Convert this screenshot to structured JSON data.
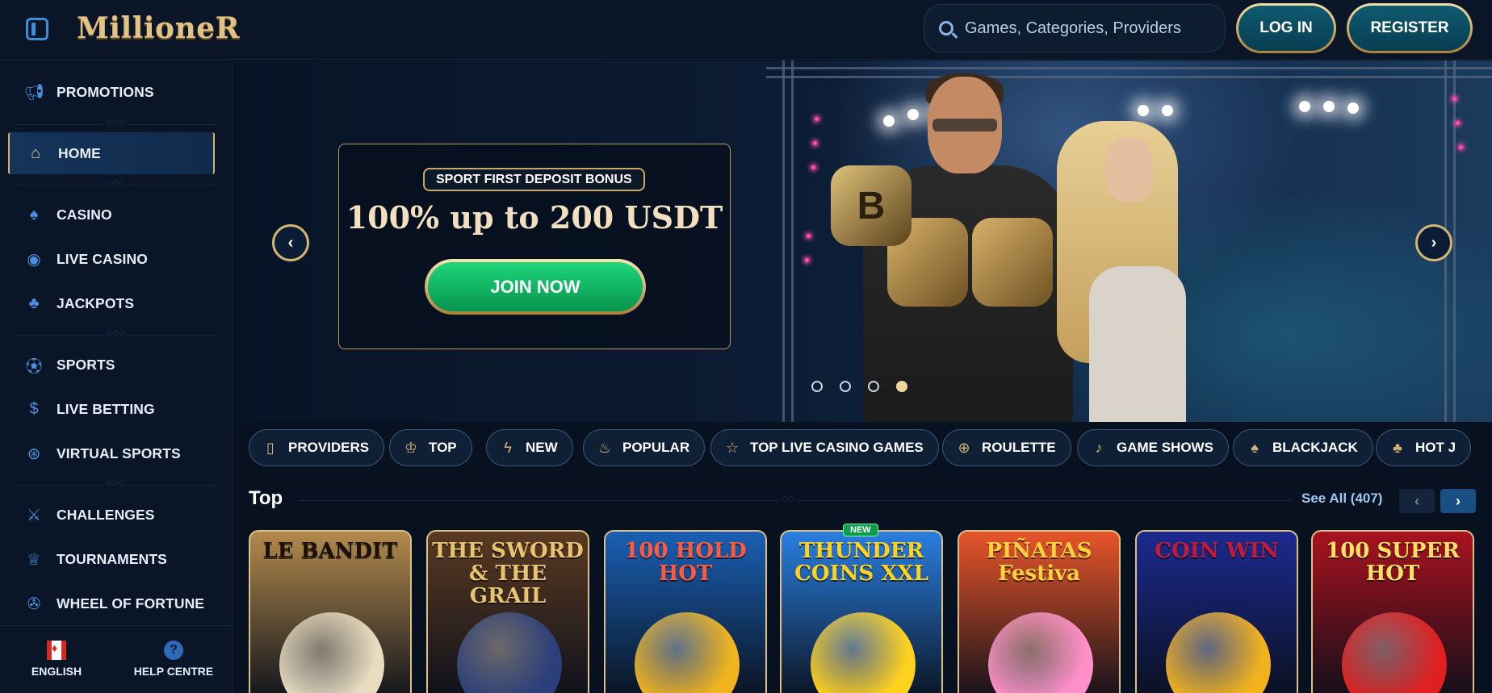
{
  "header": {
    "logo": "MillioneR",
    "search_placeholder": "Games, Categories, Providers",
    "login_label": "LOG IN",
    "register_label": "REGISTER"
  },
  "sidebar": {
    "items": [
      {
        "label": "PROMOTIONS",
        "icon": "megaphone-icon"
      },
      {
        "label": "HOME",
        "icon": "home-icon",
        "active": true
      },
      {
        "label": "CASINO",
        "icon": "spade-icon"
      },
      {
        "label": "LIVE CASINO",
        "icon": "live-casino-icon"
      },
      {
        "label": "JACKPOTS",
        "icon": "clover-icon"
      },
      {
        "label": "SPORTS",
        "icon": "soccer-ball-icon"
      },
      {
        "label": "LIVE BETTING",
        "icon": "dollar-coin-icon"
      },
      {
        "label": "VIRTUAL SPORTS",
        "icon": "virtual-sports-icon"
      },
      {
        "label": "CHALLENGES",
        "icon": "crossed-swords-icon"
      },
      {
        "label": "TOURNAMENTS",
        "icon": "trophy-icon"
      },
      {
        "label": "WHEEL OF FORTUNE",
        "icon": "wheel-icon"
      }
    ],
    "footer": {
      "language_label": "ENGLISH",
      "help_label": "HELP CENTRE",
      "help_icon_glyph": "?"
    }
  },
  "hero": {
    "tag": "SPORT FIRST DEPOSIT BONUS",
    "title": "100% up to 200 USDT",
    "cta_label": "JOIN NOW",
    "coin_glyph": "B",
    "slides_count": 4,
    "active_slide": 4
  },
  "categories": [
    {
      "label": "PROVIDERS",
      "icon": "book-icon",
      "glyph": "▯"
    },
    {
      "label": "TOP",
      "icon": "crown-icon",
      "glyph": "♔"
    },
    {
      "label": "NEW",
      "icon": "lightning-icon",
      "glyph": "ϟ"
    },
    {
      "label": "POPULAR",
      "icon": "flame-icon",
      "glyph": "♨"
    },
    {
      "label": "TOP LIVE CASINO GAMES",
      "icon": "star-icon",
      "glyph": "☆"
    },
    {
      "label": "ROULETTE",
      "icon": "roulette-icon",
      "glyph": "⊕"
    },
    {
      "label": "GAME SHOWS",
      "icon": "microphone-icon",
      "glyph": "♪"
    },
    {
      "label": "BLACKJACK",
      "icon": "cards-icon",
      "glyph": "♠"
    },
    {
      "label": "HOT J",
      "icon": "chili-icon",
      "glyph": "♣"
    }
  ],
  "section": {
    "title": "Top",
    "see_all": "See All (407)",
    "prev_glyph": "‹",
    "next_glyph": "›"
  },
  "games": [
    {
      "title": "LE BANDIT",
      "bg": "#b38a4d",
      "art": "#e8dcc0",
      "color": "#1a1208"
    },
    {
      "title": "THE SWORD & THE GRAIL",
      "bg": "#5a3a22",
      "art": "#2b3f7a",
      "color": "#e8c370"
    },
    {
      "title": "100 HOLD HOT",
      "bg": "#1a5fb4",
      "art": "#f0b41e",
      "color": "#ff5a3c"
    },
    {
      "title": "THUNDER COINS XXL",
      "bg": "#2a7fe0",
      "art": "#ffd21e",
      "color": "#ffd21e",
      "badge": "NEW"
    },
    {
      "title": "PIÑATAS Festiva",
      "bg": "#e8552a",
      "art": "#ff8fc8",
      "color": "#ffd23c"
    },
    {
      "title": "COIN WIN",
      "bg": "#1b2a8f",
      "art": "#f2b21e",
      "color": "#c41a3a"
    },
    {
      "title": "100 SUPER HOT",
      "bg": "#a8121e",
      "art": "#e02020",
      "color": "#ffe066"
    }
  ]
}
